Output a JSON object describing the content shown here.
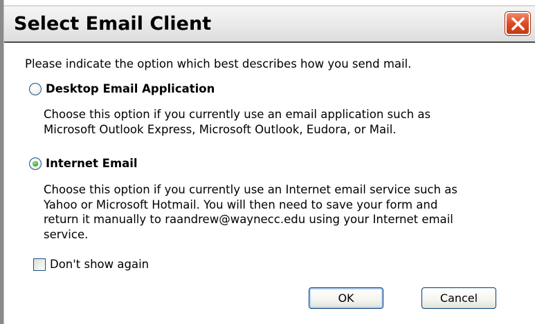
{
  "window": {
    "title": "Select Email Client",
    "close_icon": "close-x-icon",
    "close_color": "#dd4a22"
  },
  "dialog": {
    "prompt": "Please indicate the option which best describes how you send mail.",
    "options": [
      {
        "label": "Desktop Email Application",
        "selected": false,
        "description": "Choose this option if you currently use an email application such as\nMicrosoft Outlook Express, Microsoft Outlook, Eudora, or Mail."
      },
      {
        "label": "Internet Email",
        "selected": true,
        "description": "Choose this option if you currently use an Internet email service such as\nYahoo or Microsoft Hotmail. You will then need to save your form and\nreturn it manually to raandrew@waynecc.edu using your Internet email\nservice."
      }
    ],
    "dont_show_again": {
      "label": "Don't show again",
      "checked": false
    },
    "buttons": {
      "ok": "OK",
      "cancel": "Cancel"
    }
  }
}
